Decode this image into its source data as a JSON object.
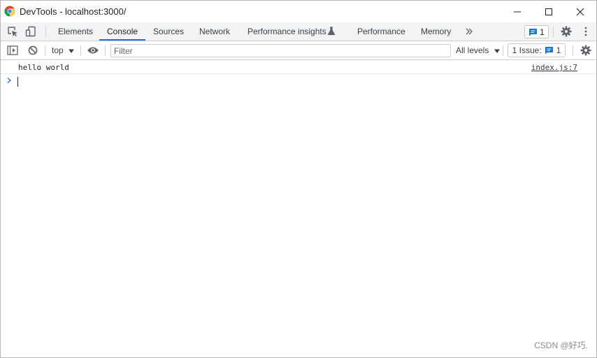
{
  "window": {
    "title": "DevTools - localhost:3000/"
  },
  "tabbar": {
    "tabs": [
      {
        "label": "Elements"
      },
      {
        "label": "Console"
      },
      {
        "label": "Sources"
      },
      {
        "label": "Network"
      },
      {
        "label": "Performance insights"
      },
      {
        "label": "Performance"
      },
      {
        "label": "Memory"
      }
    ],
    "active_tab": "Console",
    "messages_count": "1"
  },
  "console_toolbar": {
    "context": "top",
    "filter_placeholder": "Filter",
    "filter_value": "",
    "levels": "All levels",
    "issues_label": "1 Issue:",
    "issues_count": "1"
  },
  "console": {
    "messages": [
      {
        "text": "hello world",
        "source": "index.js:7"
      }
    ],
    "prompt_value": ""
  },
  "watermark": "CSDN @好巧.",
  "colors": {
    "accent": "#1a73e8",
    "toolbar_bg": "#f1f3f4",
    "icon": "#5f6368"
  }
}
